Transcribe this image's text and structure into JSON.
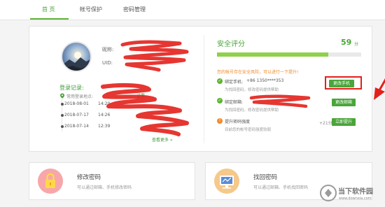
{
  "tabs": [
    {
      "label": "首 页",
      "active": true
    },
    {
      "label": "帐号保护",
      "active": false
    },
    {
      "label": "密码管理",
      "active": false
    }
  ],
  "profile": {
    "nickname_label": "昵称:",
    "uid_label": "UID:"
  },
  "login_history": {
    "title": "登录记录:",
    "location_label": "常用登录地点:",
    "set_link": "设置",
    "entries": [
      {
        "date": "2018-08-01",
        "time": "14:20"
      },
      {
        "date": "2018-07-17",
        "time": "14:26"
      },
      {
        "date": "2018-07-14",
        "time": "12:39"
      }
    ],
    "more_link": "查看更多 »"
  },
  "security": {
    "title": "安全评分",
    "score": "59",
    "score_unit": "分",
    "progress": 0.77,
    "risk_text": "您的帐号存在安全风险，可以进行一下提升!",
    "items": [
      {
        "title": "绑定手机:",
        "value": "+86 1350****353",
        "sub": "为找回密码，修改密码提供帮助",
        "button": "更改手机",
        "status": "ok"
      },
      {
        "title": "绑定邮箱:",
        "value": "",
        "sub": "为找回密码，修改密码提供帮助",
        "button": "更改邮箱",
        "status": "ok"
      },
      {
        "title": "提升密码强度",
        "value": "",
        "sub": "目前您的帐号密码强度较弱",
        "button": "立即提升",
        "status": "warn",
        "bonus": "+21分"
      }
    ]
  },
  "cards": [
    {
      "title": "修改密码",
      "sub": "可以通过邮箱、手机修改密码",
      "icon": "lock-icon"
    },
    {
      "title": "找回密码",
      "sub": "可以通过邮箱、手机找回密码",
      "icon": "monitor-icon"
    }
  ],
  "watermark": {
    "text": "当下软件园",
    "url": "www.downxia.com"
  },
  "colors": {
    "accent": "#4aa53a",
    "warning": "#f08a2b",
    "annotation": "#e3201b"
  }
}
